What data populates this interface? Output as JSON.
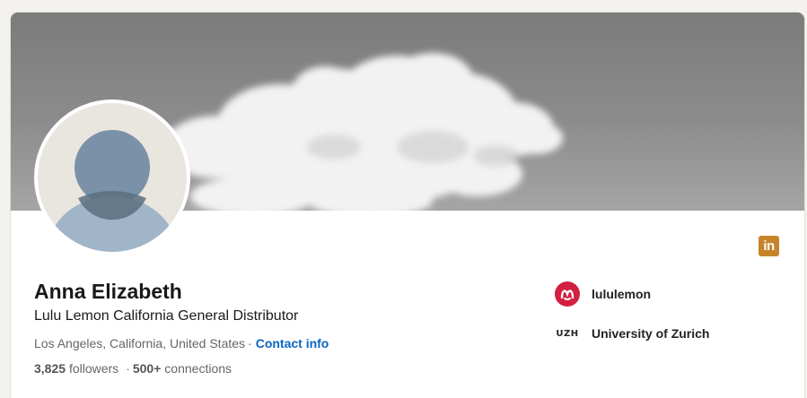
{
  "profile": {
    "name": "Anna Elizabeth",
    "headline": "Lulu Lemon California General Distributor",
    "location": "Los Angeles, California, United States",
    "location_separator": "·",
    "contact_label": "Contact info",
    "followers_count": "3,825",
    "followers_label": "followers",
    "connections_separator": "·",
    "connections_count": "500+",
    "connections_label": "connections"
  },
  "badge": {
    "text": "in",
    "icon": "linkedin-icon",
    "color": "#c6852b"
  },
  "organizations": [
    {
      "name": "lululemon",
      "logo": "lululemon-logo-icon",
      "color": "#d31f41"
    },
    {
      "name": "University of Zurich",
      "logo_text": "UZH",
      "logo": "uzh-logo-icon"
    }
  ],
  "colors": {
    "link": "#0a66c2",
    "avatar_head": "#7b91a8",
    "avatar_body": "#a0b5c8"
  }
}
